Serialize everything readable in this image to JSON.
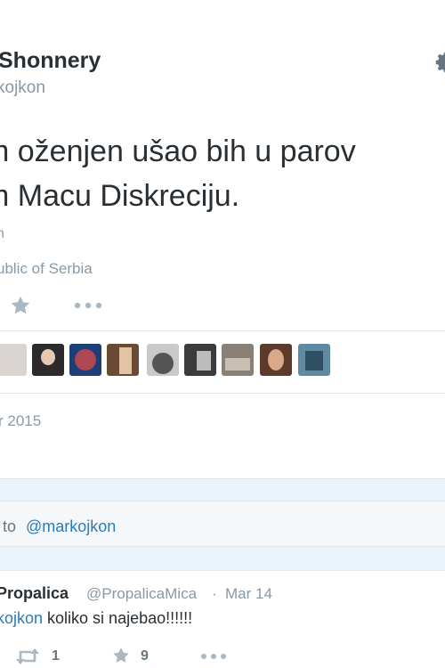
{
  "tweet": {
    "author_name": "Shonnery",
    "author_handle": "kojkon",
    "text_line1": "m oženjen ušao bih u parov",
    "text_line2": "m Macu Diskreciju.",
    "language_fragment": "n",
    "location": "ublic of Serbia",
    "date": "r 2015",
    "icons": {
      "settings": "gear-icon",
      "favorite": "star-icon",
      "more": "more-icon"
    },
    "avatars": [
      {
        "name": "avatar-1",
        "color": "#d9d4cf"
      },
      {
        "name": "avatar-2",
        "color": "#2c2a2a"
      },
      {
        "name": "avatar-3",
        "color": "#1d3f79"
      },
      {
        "name": "avatar-4",
        "color": "#6b4a33"
      },
      {
        "name": "avatar-5",
        "color": "#9a9a9a"
      },
      {
        "name": "avatar-6",
        "color": "#3b3b3b"
      },
      {
        "name": "avatar-7",
        "color": "#8a7f74"
      },
      {
        "name": "avatar-8",
        "color": "#5b3a2a"
      },
      {
        "name": "avatar-9",
        "color": "#5e8aa3"
      }
    ]
  },
  "reply_box": {
    "prefix": "to",
    "mention": "@markojkon"
  },
  "reply": {
    "author_name": "Propalica",
    "author_handle": "@PropalicaMica",
    "separator": "·",
    "date": "Mar 14",
    "mention": "kojkon",
    "body": " koliko si najebao!!!!!!",
    "retweet_count": "1",
    "favorite_count": "9",
    "icons": {
      "retweet": "retweet-icon",
      "favorite": "star-icon",
      "more": "more-icon"
    }
  },
  "colors": {
    "link": "#2b7bb9",
    "muted": "#8899a6",
    "text": "#292f33",
    "band": "#e8f3fb"
  }
}
